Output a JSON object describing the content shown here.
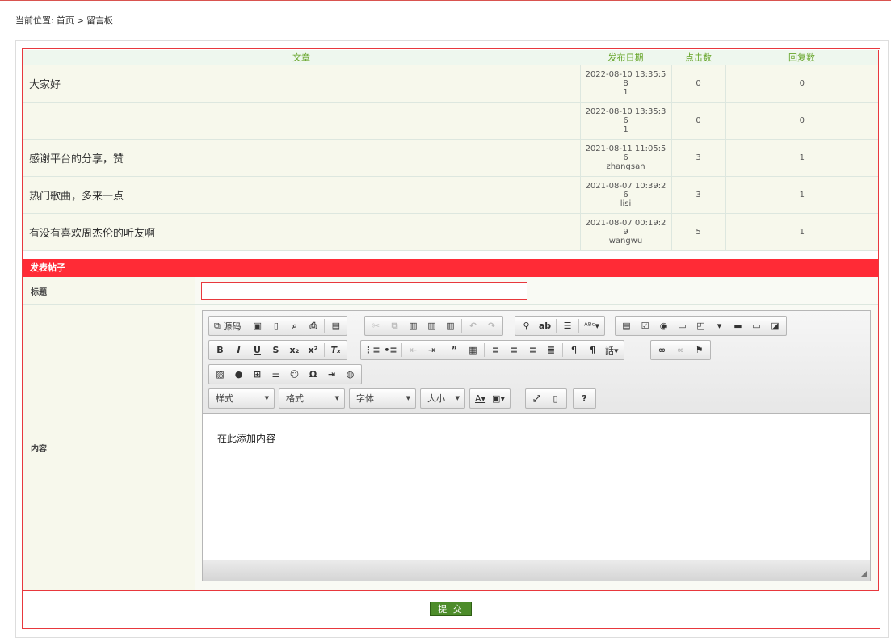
{
  "breadcrumb": {
    "prefix": "当前位置:",
    "home": "首页",
    "sep": ">",
    "current": "留言板"
  },
  "table": {
    "headers": {
      "article": "文章",
      "date": "发布日期",
      "clicks": "点击数",
      "replies": "回复数"
    },
    "rows": [
      {
        "title": "大家好",
        "date_l1": "2022-08-10 13:35:5",
        "date_l2": "8",
        "author": "1",
        "clicks": "0",
        "replies": "0"
      },
      {
        "title": "",
        "date_l1": "2022-08-10 13:35:3",
        "date_l2": "6",
        "author": "1",
        "clicks": "0",
        "replies": "0"
      },
      {
        "title": "感谢平台的分享，赞",
        "date_l1": "2021-08-11 11:05:5",
        "date_l2": "6",
        "author": "zhangsan",
        "clicks": "3",
        "replies": "1"
      },
      {
        "title": "热门歌曲，多来一点",
        "date_l1": "2021-08-07 10:39:2",
        "date_l2": "6",
        "author": "lisi",
        "clicks": "3",
        "replies": "1"
      },
      {
        "title": "有没有喜欢周杰伦的听友啊",
        "date_l1": "2021-08-07 00:19:2",
        "date_l2": "9",
        "author": "wangwu",
        "clicks": "5",
        "replies": "1"
      }
    ]
  },
  "post_form": {
    "header": "发表帖子",
    "title_label": "标题",
    "title_value": "",
    "content_label": "内容",
    "content_text": "在此添加内容",
    "submit_label": "提 交"
  },
  "editor": {
    "source_label": "源码",
    "combos": {
      "style": "样式",
      "format": "格式",
      "font": "字体",
      "size": "大小"
    },
    "help_label": "?"
  },
  "colors": {
    "accent_red": "#ff2b36",
    "header_green": "#67a52b",
    "submit_green": "#4d8c2a"
  }
}
